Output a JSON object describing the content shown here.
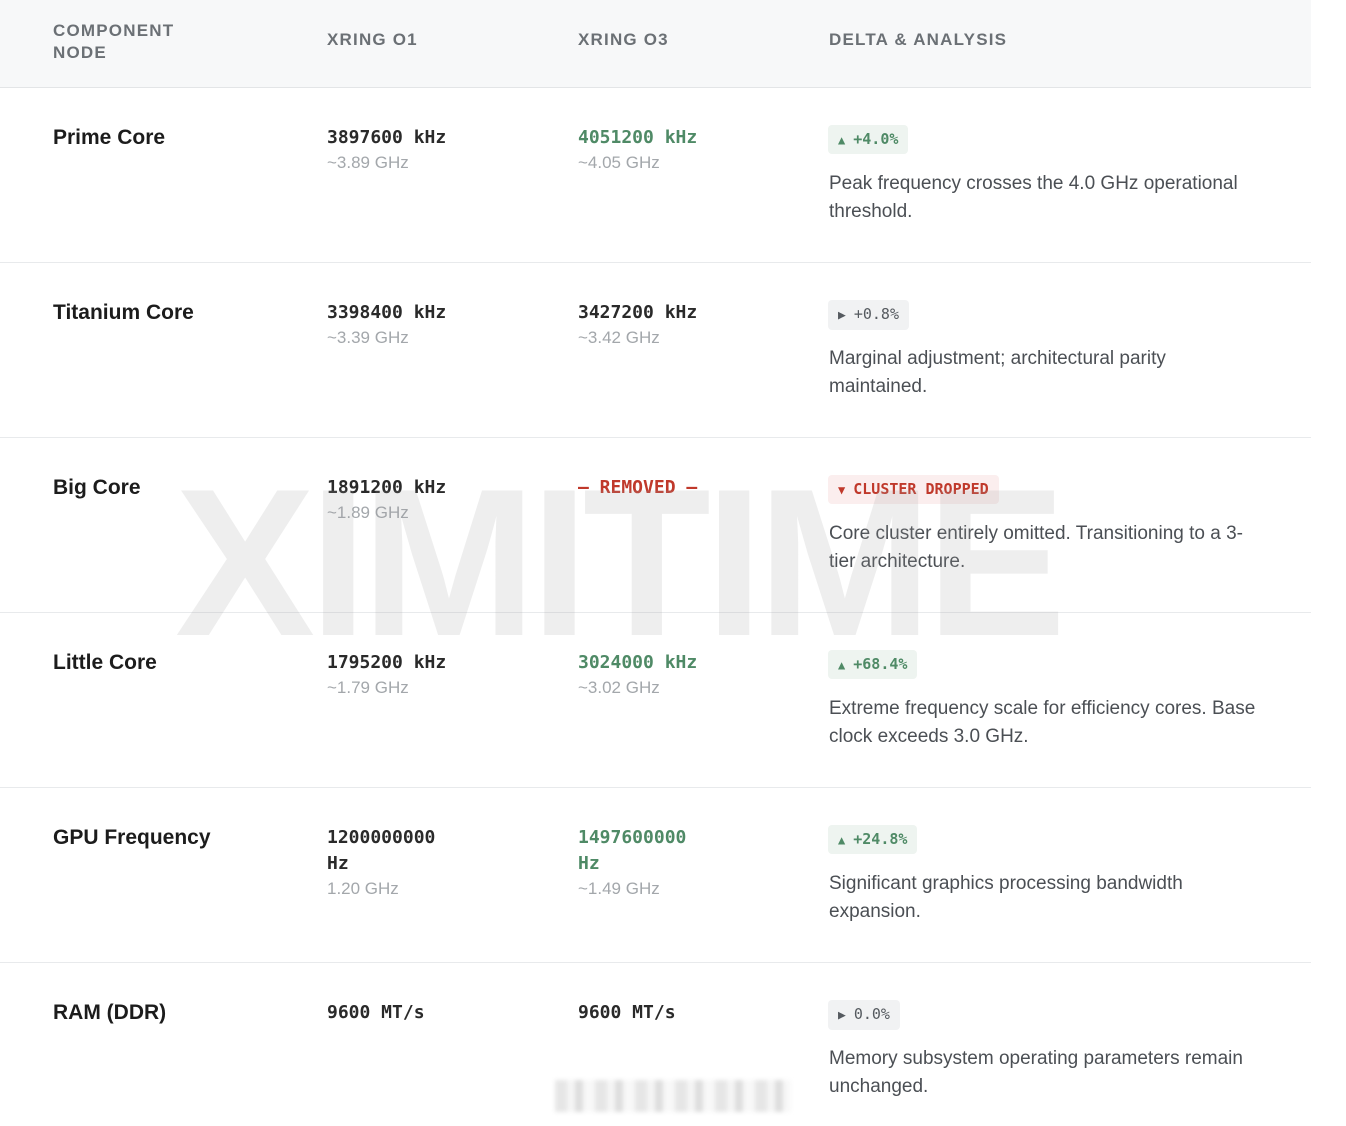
{
  "header": {
    "component": "COMPONENT NODE",
    "col_a": "XRING O1",
    "col_b": "XRING O3",
    "col_delta": "DELTA & ANALYSIS"
  },
  "rows": [
    {
      "name": "Prime Core",
      "o1_value": "3897600 kHz",
      "o1_sub": "~3.89 GHz",
      "o3_value": "4051200 kHz",
      "o3_sub": "~4.05 GHz",
      "badge_arrow": "▲",
      "badge_text": "+4.0%",
      "badge_type": "up",
      "description": "Peak frequency crosses the 4.0 GHz operational threshold."
    },
    {
      "name": "Titanium Core",
      "o1_value": "3398400 kHz",
      "o1_sub": "~3.39 GHz",
      "o3_value": "3427200 kHz",
      "o3_sub": "~3.42 GHz",
      "badge_arrow": "▶",
      "badge_text": "+0.8%",
      "badge_type": "flat",
      "description": "Marginal adjustment; architectural parity maintained."
    },
    {
      "name": "Big Core",
      "o1_value": "1891200 kHz",
      "o1_sub": "~1.89 GHz",
      "o3_value": "— REMOVED —",
      "o3_sub": "",
      "badge_arrow": "▼",
      "badge_text": "CLUSTER DROPPED",
      "badge_type": "down",
      "description": "Core cluster entirely omitted. Transitioning to a 3-tier architecture."
    },
    {
      "name": "Little Core",
      "o1_value": "1795200 kHz",
      "o1_sub": "~1.79 GHz",
      "o3_value": "3024000 kHz",
      "o3_sub": "~3.02 GHz",
      "badge_arrow": "▲",
      "badge_text": "+68.4%",
      "badge_type": "up",
      "description": "Extreme frequency scale for efficiency cores. Base clock exceeds 3.0 GHz."
    },
    {
      "name": "GPU Frequency",
      "o1_value": "1200000000 Hz",
      "o1_sub": "1.20 GHz",
      "o3_value": "1497600000 Hz",
      "o3_sub": "~1.49 GHz",
      "badge_arrow": "▲",
      "badge_text": "+24.8%",
      "badge_type": "up",
      "description": "Significant graphics processing bandwidth expansion."
    },
    {
      "name": "RAM (DDR)",
      "o1_value": "9600 MT/s",
      "o1_sub": "",
      "o3_value": "9600 MT/s",
      "o3_sub": "",
      "badge_arrow": "▶",
      "badge_text": "0.0%",
      "badge_type": "flat",
      "description": "Memory subsystem operating parameters remain unchanged."
    }
  ],
  "watermark": "XIMITIME",
  "colors": {
    "increase": "#4f8a66",
    "removed": "#c0392b",
    "muted": "#a3a7ab"
  }
}
